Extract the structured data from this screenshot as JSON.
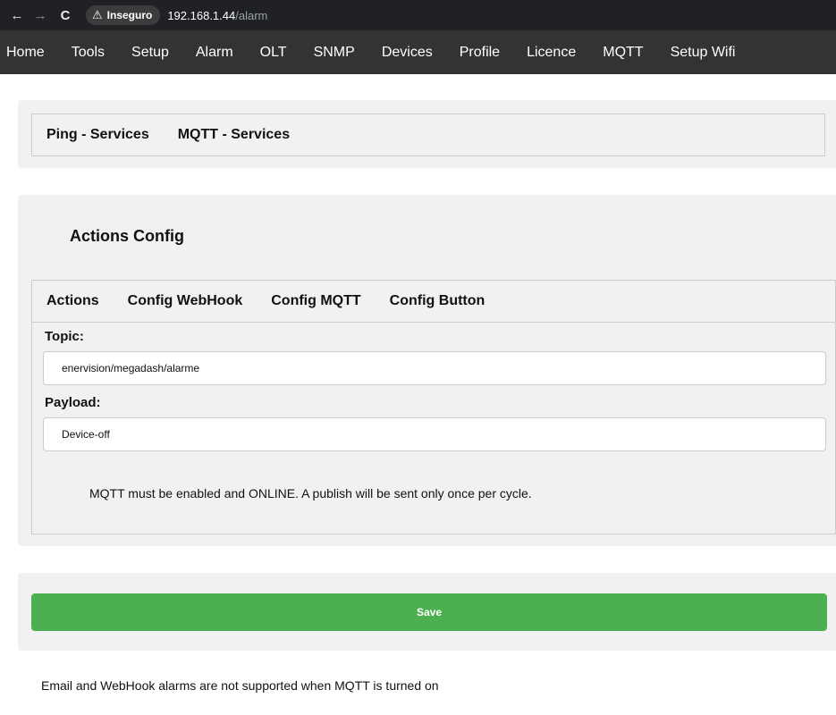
{
  "browser": {
    "back_icon": "←",
    "forward_icon": "→",
    "reload_icon": "C",
    "security_badge": "Inseguro",
    "warning_icon": "⚠",
    "url_host": "192.168.1.44",
    "url_path": "/alarm"
  },
  "navbar": {
    "items": [
      "Home",
      "Tools",
      "Setup",
      "Alarm",
      "OLT",
      "SNMP",
      "Devices",
      "Profile",
      "Licence",
      "MQTT",
      "Setup Wifi"
    ]
  },
  "services_tabs": [
    "Ping - Services",
    "MQTT - Services"
  ],
  "actions_config": {
    "title": "Actions Config",
    "tabs": [
      "Actions",
      "Config WebHook",
      "Config MQTT",
      "Config Button"
    ],
    "topic_label": "Topic:",
    "topic_value": "enervision/megadash/alarme",
    "payload_label": "Payload:",
    "payload_value": "Device-off",
    "note": "MQTT must be enabled and ONLINE. A publish will be sent only once per cycle."
  },
  "save_label": "Save",
  "footer_note": "Email and WebHook alarms are not supported when MQTT is turned on",
  "colors": {
    "navbar_bg": "#333333",
    "panel_bg": "#f1f1f1",
    "save_button": "#4caf50"
  }
}
